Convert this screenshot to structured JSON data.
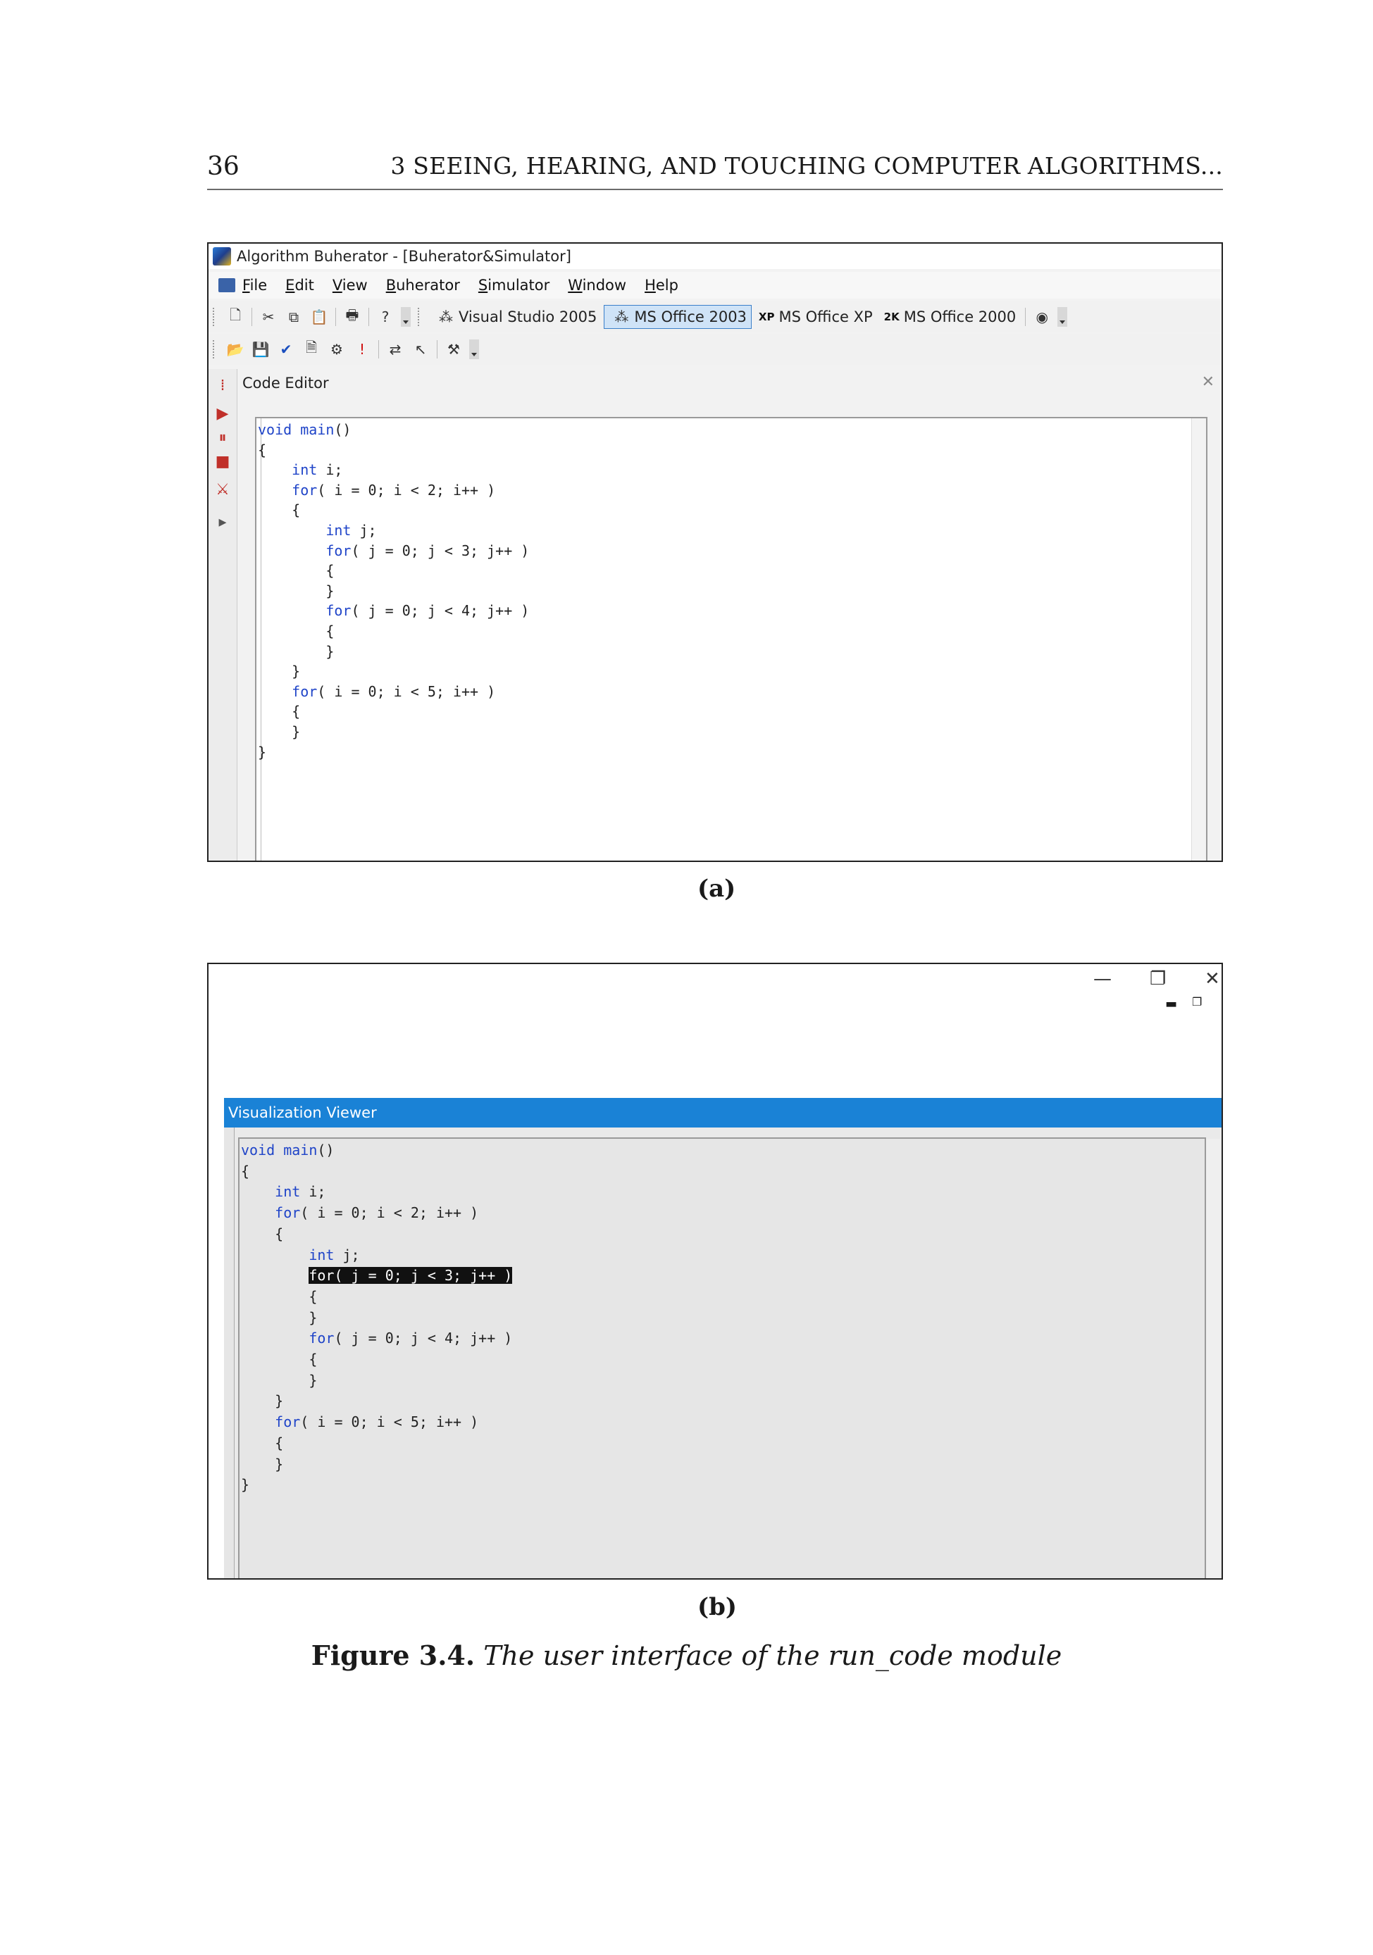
{
  "page": {
    "number": "36",
    "running_head": "3 SEEING, HEARING, AND TOUCHING COMPUTER ALGORITHMS..."
  },
  "figure_a": {
    "window_title": "Algorithm Buherator - [Buherator&Simulator]",
    "menu": [
      "File",
      "Edit",
      "View",
      "Buherator",
      "Simulator",
      "Window",
      "Help"
    ],
    "styles": [
      "Visual Studio 2005",
      "MS Office 2003",
      "MS Office XP",
      "MS Office 2000"
    ],
    "style_marks": [
      "XP",
      "2K"
    ],
    "panel_title": "Code Editor",
    "code": [
      "void main()",
      "{",
      "    int i;",
      "    for( i = 0; i < 2; i++ )",
      "    {",
      "        int j;",
      "        for( j = 0; j < 3; j++ )",
      "        {",
      "        }",
      "        for( j = 0; j < 4; j++ )",
      "        {",
      "        }",
      "    }",
      "    for( i = 0; i < 5; i++ )",
      "    {",
      "    }",
      "}"
    ],
    "subcaption": "(a)"
  },
  "figure_b": {
    "panel_title": "Visualization Viewer",
    "highlighted_line": 6,
    "subcaption": "(b)"
  },
  "caption": {
    "label": "Figure 3.4.",
    "text": "The user interface of the run_code module"
  }
}
